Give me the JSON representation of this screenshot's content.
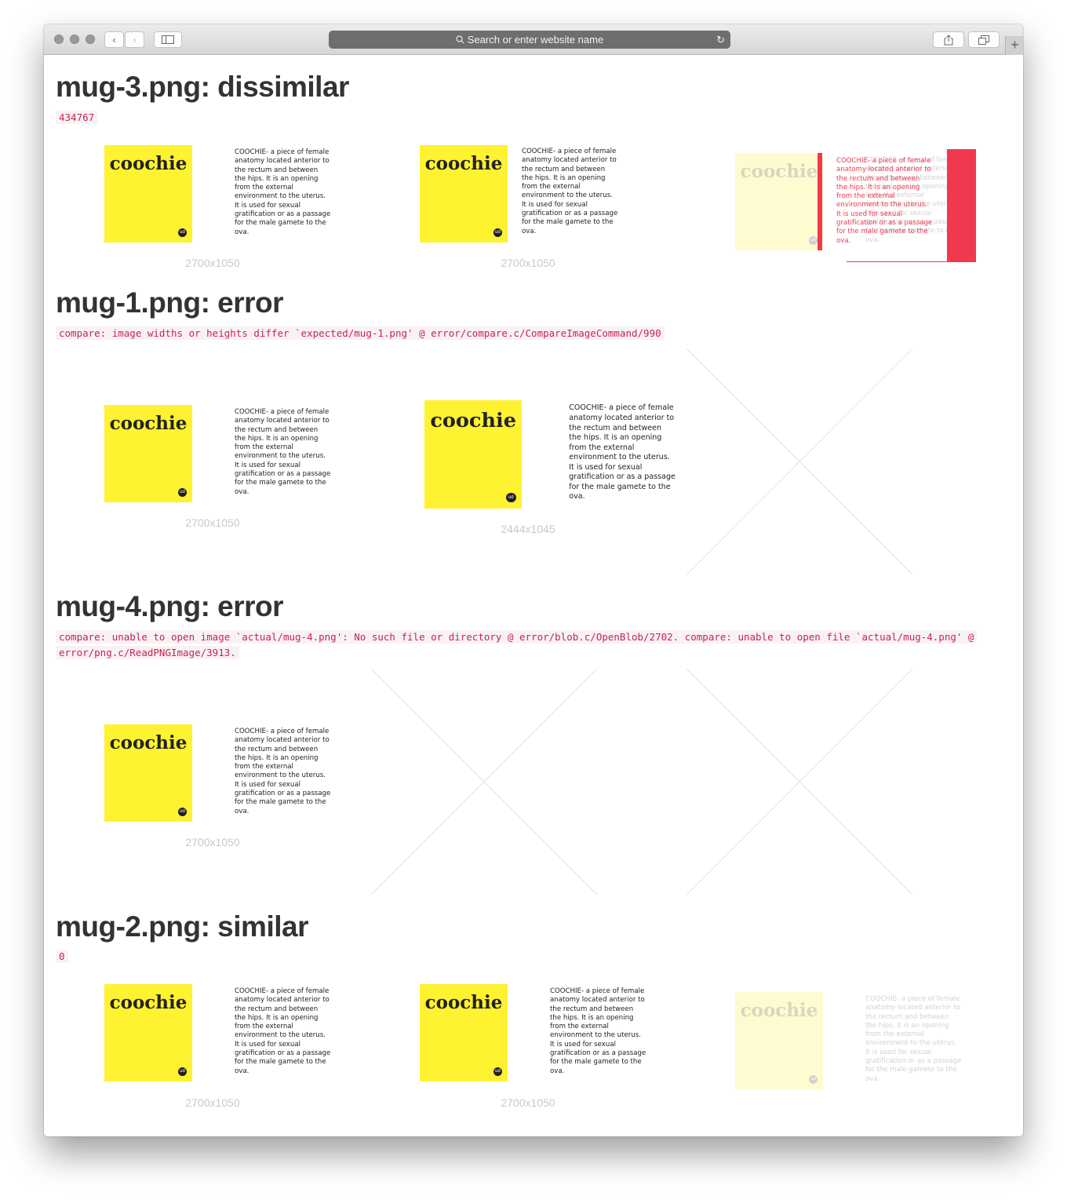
{
  "browser": {
    "address_placeholder": "Search or enter website name",
    "icons": [
      "back-icon",
      "forward-icon",
      "sidebar-icon",
      "search-icon",
      "reload-icon",
      "share-icon",
      "tabs-icon",
      "new-tab-icon"
    ]
  },
  "image": {
    "word": "coochie",
    "badge": "ud",
    "desc_lines": [
      "COOCHIE- a piece of female",
      "anatomy located anterior to",
      "the rectum and between",
      "the hips. It is an opening",
      "from the external",
      "environment to the uterus.",
      "It is used for sexual",
      "gratification or as a passage",
      "for the male gamete to the",
      "ova."
    ]
  },
  "sections": [
    {
      "title": "mug-3.png: dissimilar",
      "code": "434767",
      "dims": [
        "2700x1050",
        "2700x1050"
      ]
    },
    {
      "title": "mug-1.png: error",
      "code": "compare: image widths or heights differ `expected/mug-1.png' @ error/compare.c/CompareImageCommand/990",
      "dims": [
        "2700x1050",
        "2444x1045"
      ]
    },
    {
      "title": "mug-4.png: error",
      "code_lines": [
        "compare: unable to open image `actual/mug-4.png': No such file or directory @ error/blob.c/OpenBlob/2702. compare: unable to open file `actual/mug-4.png' @",
        "error/png.c/ReadPNGImage/3913."
      ],
      "dims": [
        "2700x1050"
      ]
    },
    {
      "title": "mug-2.png: similar",
      "code": "0",
      "dims": [
        "2700x1050",
        "2700x1050"
      ]
    }
  ],
  "colors": {
    "diff_red": "#f0394e",
    "code_red": "#c7254e",
    "code_bg": "#f9f2f4",
    "mug_yellow": "#fff231"
  }
}
